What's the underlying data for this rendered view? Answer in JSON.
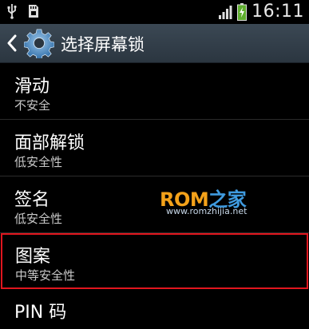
{
  "status_bar": {
    "time": "16:11",
    "icons": [
      "usb-icon",
      "sd-card-icon",
      "signal-icon",
      "battery-charging-icon"
    ]
  },
  "action_bar": {
    "title": "选择屏幕锁",
    "icons": [
      "back-icon",
      "settings-gear-icon"
    ]
  },
  "options": [
    {
      "title": "滑动",
      "subtitle": "不安全"
    },
    {
      "title": "面部解锁",
      "subtitle": "低安全性"
    },
    {
      "title": "签名",
      "subtitle": "低安全性"
    },
    {
      "title": "图案",
      "subtitle": "中等安全性",
      "highlighted": true
    },
    {
      "title": "PIN 码"
    }
  ],
  "watermark": {
    "logo_part1": "ROM",
    "logo_part2": "之家",
    "url": "www.romzhijia.net"
  },
  "colors": {
    "highlight_border": "#e0161e",
    "action_bar": "#36424d",
    "background": "#000000"
  }
}
